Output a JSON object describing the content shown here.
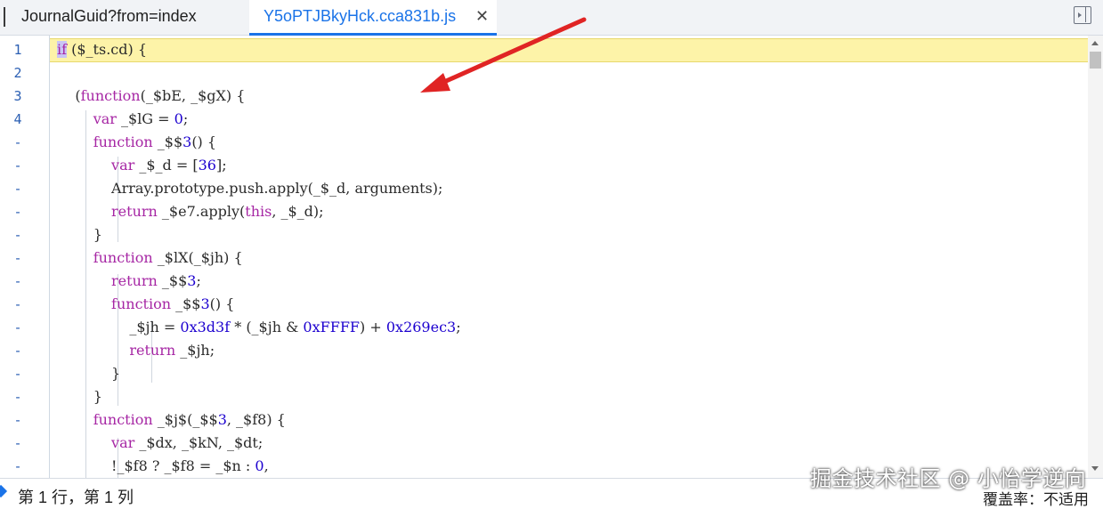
{
  "tabs": [
    {
      "label": "JournalGuid?from=index",
      "active": false
    },
    {
      "label": "Y5oPTJBkyHck.cca831b.js",
      "active": true
    }
  ],
  "tab_close_symbol": "✕",
  "line_numbers": [
    "1",
    "2",
    "3",
    "4",
    "-",
    "-",
    "-",
    "-",
    "-",
    "-",
    "-",
    "-",
    "-",
    "-",
    "-",
    "-",
    "-",
    "-",
    "-"
  ],
  "code_lines": [
    "if ($_ts.cd) {",
    "",
    "    (function(_$bE, _$gX) {",
    "        var _$lG = 0;",
    "        function _$$3() {",
    "            var _$_d = [36];",
    "            Array.prototype.push.apply(_$_d, arguments);",
    "            return _$e7.apply(this, _$_d);",
    "        }",
    "        function _$lX(_$jh) {",
    "            return _$$3;",
    "            function _$$3() {",
    "                _$jh = 0x3d3f * (_$jh & 0xFFFF) + 0x269ec3;",
    "                return _$jh;",
    "            }",
    "        }",
    "        function _$j$(_$$3, _$f8) {",
    "            var _$dx, _$kN, _$dt;",
    "            !_$f8 ? _$f8 = _$n : 0,"
  ],
  "status": {
    "position": "第 1 行，第 1 列",
    "coverage": "覆盖率：不适用"
  },
  "watermark": "掘金技术社区 @ 小怡学逆向",
  "colors": {
    "accent": "#1a73e8",
    "line_highlight": "#fdf3a8",
    "keyword": "#a626a4",
    "number": "#1c00cf",
    "annotation_arrow": "#e02424"
  },
  "icons": [
    "close-icon",
    "panel-toggle-icon",
    "scroll-up-icon",
    "scroll-down-icon",
    "status-sync-icon",
    "annotation-arrow"
  ]
}
